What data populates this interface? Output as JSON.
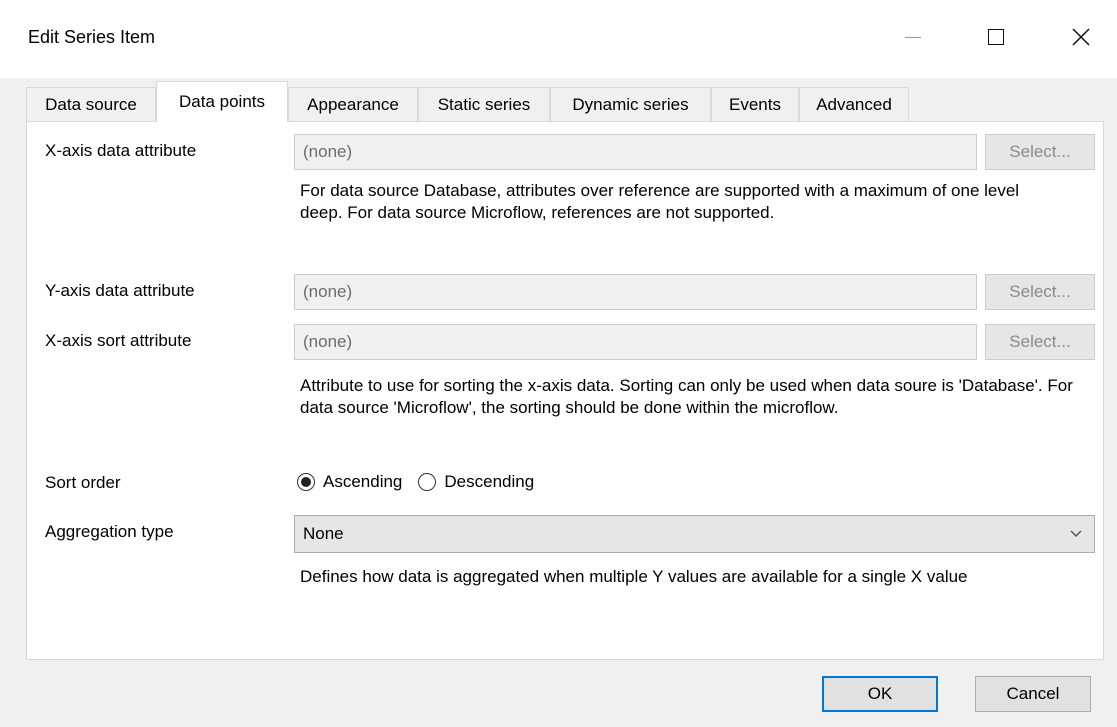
{
  "window": {
    "title": "Edit Series Item",
    "controls": {
      "minimize": "minimize-icon",
      "maximize": "maximize-icon",
      "close": "close-icon"
    }
  },
  "tabs": [
    {
      "label": "Data source",
      "active": false
    },
    {
      "label": "Data points",
      "active": true
    },
    {
      "label": "Appearance",
      "active": false
    },
    {
      "label": "Static series",
      "active": false
    },
    {
      "label": "Dynamic series",
      "active": false
    },
    {
      "label": "Events",
      "active": false
    },
    {
      "label": "Advanced",
      "active": false
    }
  ],
  "form": {
    "x_axis": {
      "label": "X-axis data attribute",
      "value": "(none)",
      "select_label": "Select...",
      "description": "For data source Database, attributes over reference are supported with a maximum of one level deep. For data source Microflow, references are not supported."
    },
    "y_axis": {
      "label": "Y-axis data attribute",
      "value": "(none)",
      "select_label": "Select..."
    },
    "x_sort": {
      "label": "X-axis sort attribute",
      "value": "(none)",
      "select_label": "Select...",
      "description": "Attribute to use for sorting the x-axis data. Sorting can only be used when data soure is 'Database'.  For data source 'Microflow', the sorting should be done within the microflow."
    },
    "sort_order": {
      "label": "Sort order",
      "options": [
        "Ascending",
        "Descending"
      ],
      "selected": "Ascending"
    },
    "aggregation": {
      "label": "Aggregation type",
      "value": "None",
      "description": "Defines how data is aggregated when multiple Y values are available for a single X value"
    }
  },
  "footer": {
    "ok_label": "OK",
    "cancel_label": "Cancel"
  }
}
